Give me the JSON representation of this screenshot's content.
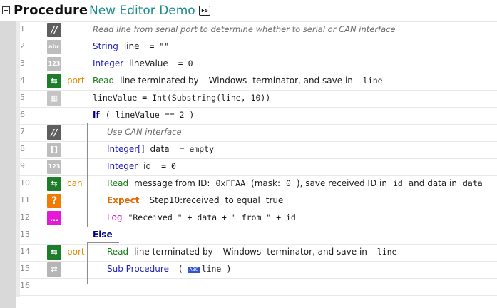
{
  "title": {
    "keyword": "Procedure",
    "name": "New Editor Demo",
    "badge": "F5"
  },
  "lines": [
    {
      "num": "1",
      "icon": "//",
      "tag": "",
      "parts": [
        "Read line from serial port to determine whether to serial or CAN interface"
      ]
    },
    {
      "num": "2",
      "icon": "abc",
      "tag": "",
      "parts": [
        "String",
        "line",
        "= \"\""
      ]
    },
    {
      "num": "3",
      "icon": "123",
      "tag": "",
      "parts": [
        "Integer",
        "lineValue",
        "= 0"
      ]
    },
    {
      "num": "4",
      "icon": "⇆",
      "tag": "port",
      "parts": [
        "Read",
        "line terminated by",
        "Windows",
        "terminator, and save in",
        "line"
      ]
    },
    {
      "num": "5",
      "icon": "▦",
      "tag": "",
      "parts": [
        "lineValue = Int(Substring(line, 10))"
      ]
    },
    {
      "num": "6",
      "icon": "",
      "tag": "",
      "parts": [
        "If",
        "( lineValue == 2 )"
      ]
    },
    {
      "num": "7",
      "icon": "//",
      "tag": "",
      "parts": [
        "Use CAN interface"
      ]
    },
    {
      "num": "8",
      "icon": "[]",
      "tag": "",
      "parts": [
        "Integer[]",
        "data",
        "= empty"
      ]
    },
    {
      "num": "9",
      "icon": "123",
      "tag": "",
      "parts": [
        "Integer",
        "id",
        "= 0"
      ]
    },
    {
      "num": "10",
      "icon": "⇆",
      "tag": "can",
      "parts": [
        "Read",
        "message from ID:",
        "0xFFAA",
        "(mask:",
        "0",
        "), save received ID in",
        "id",
        "and data in",
        "data"
      ]
    },
    {
      "num": "11",
      "icon": "?",
      "tag": "",
      "parts": [
        "Expect",
        "Step10:received",
        "to equal",
        "true"
      ]
    },
    {
      "num": "12",
      "icon": "…",
      "tag": "",
      "parts": [
        "Log",
        "\"Received \" + data + \" from \" + id"
      ]
    },
    {
      "num": "13",
      "icon": "",
      "tag": "",
      "parts": [
        "Else"
      ]
    },
    {
      "num": "14",
      "icon": "⇆",
      "tag": "port",
      "parts": [
        "Read",
        "line terminated by",
        "Windows",
        "terminator, and save in",
        "line"
      ]
    },
    {
      "num": "15",
      "icon": "⇄",
      "tag": "",
      "parts": [
        "Sub Procedure",
        "(",
        "line",
        ")"
      ],
      "chip": "ABC"
    },
    {
      "num": "16",
      "icon": "",
      "tag": "",
      "parts": []
    }
  ]
}
